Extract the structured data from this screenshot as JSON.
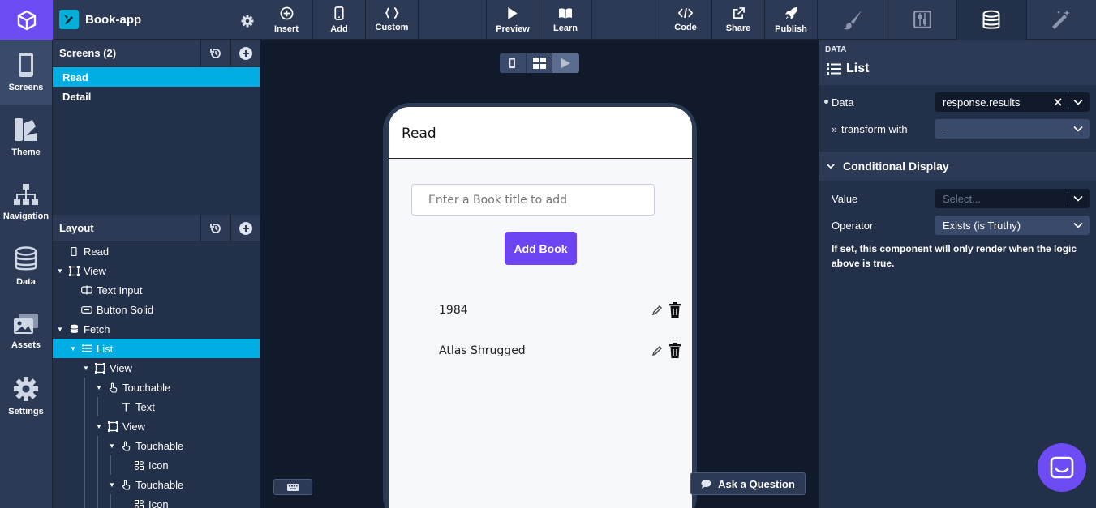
{
  "rail": {
    "items": [
      {
        "label": "Screens",
        "icon": "phone-icon"
      },
      {
        "label": "Theme",
        "icon": "theme-icon"
      },
      {
        "label": "Navigation",
        "icon": "navigation-icon"
      },
      {
        "label": "Data",
        "icon": "database-icon"
      },
      {
        "label": "Assets",
        "icon": "images-icon"
      },
      {
        "label": "Settings",
        "icon": "gear-icon"
      }
    ]
  },
  "app": {
    "name": "Book-app"
  },
  "screens": {
    "title": "Screens (2)",
    "items": [
      {
        "label": "Read",
        "selected": true
      },
      {
        "label": "Detail",
        "selected": false
      }
    ]
  },
  "layout": {
    "title": "Layout",
    "tree": [
      {
        "label": "Read",
        "icon": "phone-icon",
        "depth": 0,
        "caret": false
      },
      {
        "label": "View",
        "icon": "view-icon",
        "depth": 0,
        "caret": true
      },
      {
        "label": "Text Input",
        "icon": "text-input-icon",
        "depth": 1,
        "caret": false
      },
      {
        "label": "Button Solid",
        "icon": "button-icon",
        "depth": 1,
        "caret": false
      },
      {
        "label": "Fetch",
        "icon": "database-icon",
        "depth": 0,
        "caret": true
      },
      {
        "label": "List",
        "icon": "list-icon",
        "depth": 1,
        "caret": true,
        "selected": true
      },
      {
        "label": "View",
        "icon": "view-icon",
        "depth": 2,
        "caret": true
      },
      {
        "label": "Touchable",
        "icon": "touch-icon",
        "depth": 3,
        "caret": true
      },
      {
        "label": "Text",
        "icon": "text-icon",
        "depth": 4,
        "caret": false
      },
      {
        "label": "View",
        "icon": "view-icon",
        "depth": 3,
        "caret": true
      },
      {
        "label": "Touchable",
        "icon": "touch-icon",
        "depth": 4,
        "caret": true
      },
      {
        "label": "Icon",
        "icon": "icon-component-icon",
        "depth": 5,
        "caret": false
      },
      {
        "label": "Touchable",
        "icon": "touch-icon",
        "depth": 4,
        "caret": true
      },
      {
        "label": "Icon",
        "icon": "icon-component-icon",
        "depth": 5,
        "caret": false
      }
    ]
  },
  "toolbar": {
    "insert": "Insert",
    "add": "Add",
    "custom": "Custom",
    "preview": "Preview",
    "learn": "Learn",
    "code": "Code",
    "share": "Share",
    "publish": "Publish"
  },
  "phone": {
    "title": "Read",
    "input_placeholder": "Enter a Book title to add",
    "button": "Add Book",
    "books": [
      "1984",
      "Atlas Shrugged"
    ]
  },
  "canvas": {
    "ask": "Ask a Question"
  },
  "right": {
    "section_small": "DATA",
    "component": "List",
    "data_label": "Data",
    "data_value": "response.results",
    "transform_label": "transform with",
    "transform_value": "-",
    "conditional_title": "Conditional Display",
    "value_label": "Value",
    "value_placeholder": "Select...",
    "operator_label": "Operator",
    "operator_value": "Exists (is Truthy)",
    "help": "If set, this component will only render when the logic above is true."
  },
  "colors": {
    "accent": "#6d4cf5",
    "selection": "#00aee4",
    "panel": "#223049",
    "header": "#2c3a55",
    "canvas": "#111a2b"
  }
}
